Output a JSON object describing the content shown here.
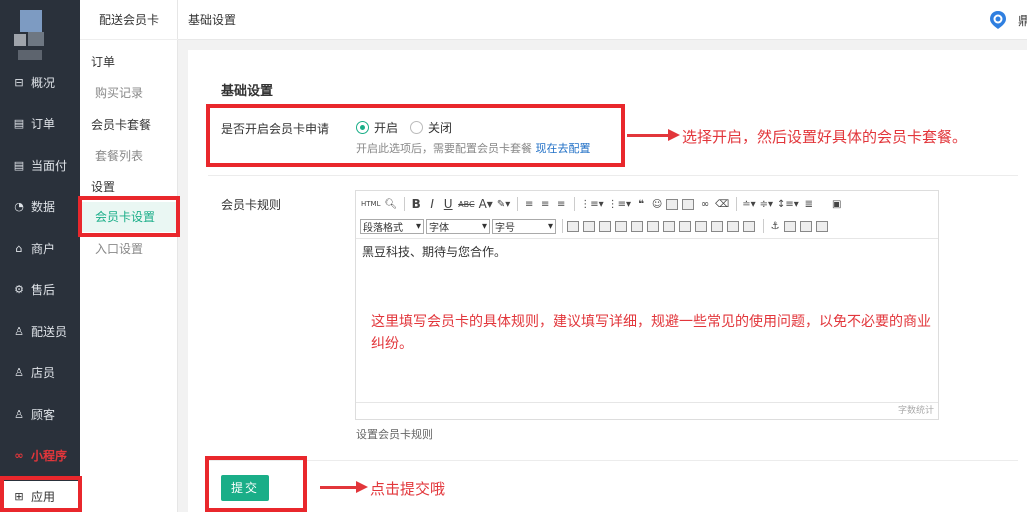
{
  "nav": {
    "items": [
      {
        "label": "概况",
        "icon": "dashboard-icon"
      },
      {
        "label": "订单",
        "icon": "order-icon"
      },
      {
        "label": "当面付",
        "icon": "pay-icon"
      },
      {
        "label": "数据",
        "icon": "data-icon"
      },
      {
        "label": "商户",
        "icon": "shop-icon"
      },
      {
        "label": "售后",
        "icon": "service-icon"
      },
      {
        "label": "配送员",
        "icon": "courier-icon"
      },
      {
        "label": "店员",
        "icon": "clerk-icon"
      },
      {
        "label": "顾客",
        "icon": "customer-icon"
      },
      {
        "label": "小程序",
        "icon": "miniapp-icon"
      },
      {
        "label": "应用",
        "icon": "apps-icon"
      }
    ]
  },
  "subnav": {
    "title": "配送会员卡",
    "groups": [
      {
        "label": "订单",
        "items": [
          "购买记录"
        ]
      },
      {
        "label": "会员卡套餐",
        "items": [
          "套餐列表"
        ]
      },
      {
        "label": "设置",
        "items": [
          "会员卡设置",
          "入口设置"
        ]
      }
    ]
  },
  "topbar": {
    "title": "基础设置",
    "user_initial": "鼎"
  },
  "form": {
    "section_title": "基础设置",
    "enable_label": "是否开启会员卡申请",
    "option_on": "开启",
    "option_off": "关闭",
    "selected": "开启",
    "help_text": "开启此选项后，需要配置会员卡套餐",
    "help_link": "现在去配置",
    "rules_label": "会员卡规则",
    "rules_help": "设置会员卡规则",
    "submit_label": "提交"
  },
  "editor": {
    "para_format": "段落格式",
    "font_family": "字体",
    "font_size": "字号",
    "content": "黑豆科技、期待与您合作。",
    "word_count": "字数统计",
    "html_label": "HTML"
  },
  "annotations": {
    "enable_note": "选择开启，然后设置好具体的会员卡套餐。",
    "rules_note": "这里填写会员卡的具体规则，建议填写详细，规避一些常见的使用问题，以免不必要的商业纠纷。",
    "submit_note": "点击提交哦"
  },
  "colors": {
    "accent": "#1aae88",
    "annotation": "#e2363b",
    "nav_bg": "#2a313b"
  }
}
